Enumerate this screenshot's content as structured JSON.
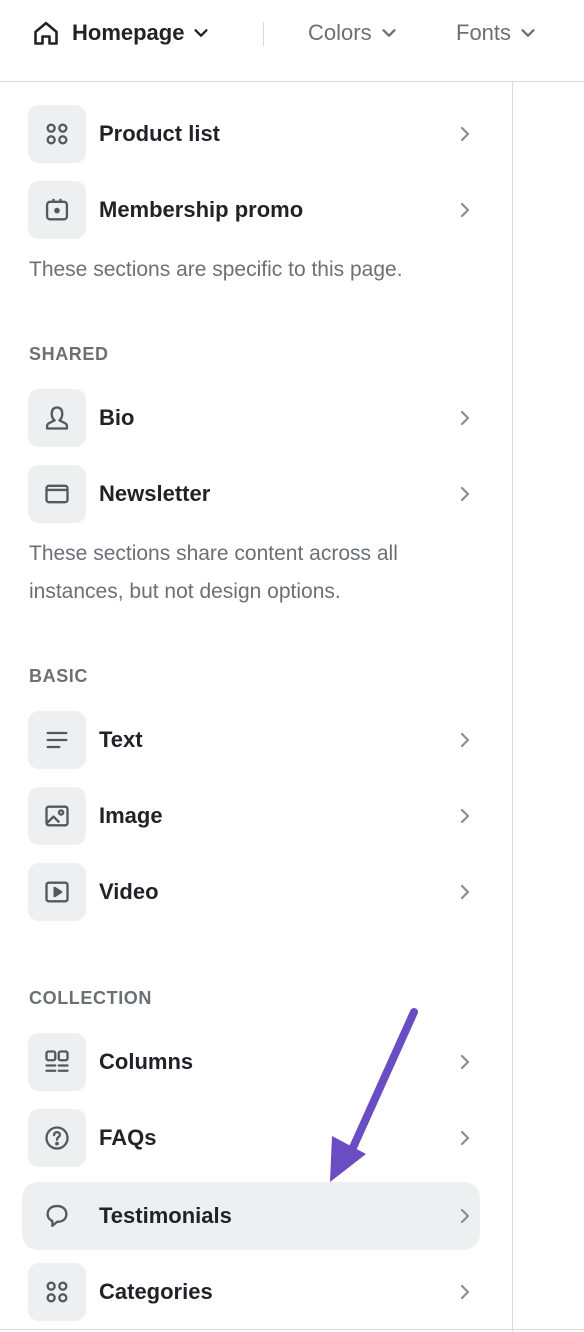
{
  "topbar": {
    "page_selector": "Homepage",
    "colors": "Colors",
    "fonts": "Fonts"
  },
  "page_sections": {
    "items": [
      {
        "label": "Product list",
        "icon": "grid-icon"
      },
      {
        "label": "Membership promo",
        "icon": "promo-icon"
      }
    ],
    "note": "These sections are specific to this page."
  },
  "shared": {
    "heading": "SHARED",
    "items": [
      {
        "label": "Bio",
        "icon": "person-icon"
      },
      {
        "label": "Newsletter",
        "icon": "mail-icon"
      }
    ],
    "note": "These sections share content across all instances, but not design options."
  },
  "basic": {
    "heading": "BASIC",
    "items": [
      {
        "label": "Text",
        "icon": "text-lines-icon"
      },
      {
        "label": "Image",
        "icon": "image-icon"
      },
      {
        "label": "Video",
        "icon": "video-icon"
      }
    ]
  },
  "collection": {
    "heading": "COLLECTION",
    "items": [
      {
        "label": "Columns",
        "icon": "columns-icon"
      },
      {
        "label": "FAQs",
        "icon": "question-icon"
      },
      {
        "label": "Testimonials",
        "icon": "speech-bubble-icon",
        "highlighted": true
      },
      {
        "label": "Categories",
        "icon": "grid-icon"
      }
    ]
  },
  "colors": {
    "text": "#1f2328",
    "muted": "#6b7075",
    "tile_bg": "#eeeff1",
    "arrow": "#6a4cc3"
  }
}
